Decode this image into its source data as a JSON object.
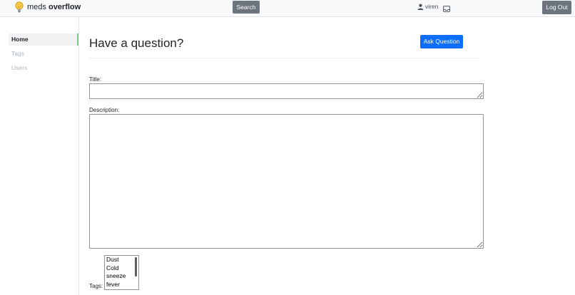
{
  "header": {
    "brand_light": "meds ",
    "brand_bold": "overflow",
    "search_label": "Search",
    "username": "viren",
    "logout_label": "Log Out"
  },
  "sidebar": {
    "items": [
      {
        "label": "Home",
        "active": true
      },
      {
        "label": "Tags",
        "active": false
      },
      {
        "label": "Users",
        "active": false
      }
    ]
  },
  "main": {
    "title": "Have a question?",
    "ask_label": "Ask Question",
    "title_field_label": "Title:",
    "title_value": "",
    "description_label": "Description:",
    "description_value": "",
    "tags_label": "Tags:",
    "tag_options": [
      "Dust",
      "Cold",
      "sneeze",
      "fever"
    ]
  },
  "colors": {
    "primary": "#0d6efd",
    "secondary": "#6c757d",
    "active_indicator": "#7fc48e"
  }
}
